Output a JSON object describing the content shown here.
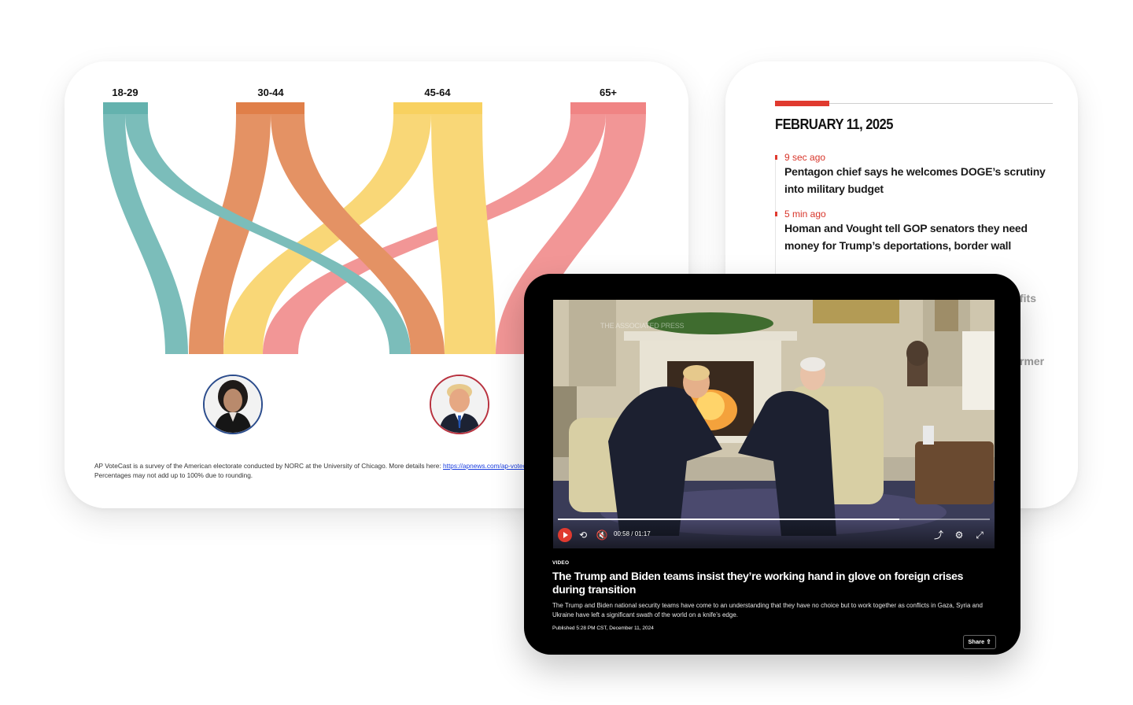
{
  "chart_card": {
    "age_groups": [
      "18-29",
      "30-44",
      "45-64",
      "65+"
    ],
    "footnote_line1": "AP VoteCast is a survey of the American electorate conducted by NORC at the University of Chicago. More details here: ",
    "footnote_link": "https://apnews.com/ap-votecast-fa",
    "footnote_line2": "Percentages may not add up to 100% due to rounding."
  },
  "colors": {
    "teal": "#64b2ae",
    "orange": "#e07f49",
    "yellow": "#f8d160",
    "pink": "#f08484",
    "harris_ring": "#2b4c8c",
    "trump_ring": "#b8323f",
    "accent_red": "#e03a2f"
  },
  "news_card": {
    "date": "FEBRUARY 11, 2025",
    "items": [
      {
        "time": "9 sec ago",
        "headline": "Pentagon chief says he welcomes DOGE’s scrutiny into military budget"
      },
      {
        "time": "5 min ago",
        "headline": "Homan and Vought tell GOP senators they need money for Trump’s deportations, border wall"
      }
    ],
    "ghost_text_1": "fits",
    "ghost_text_2": "rmer"
  },
  "video": {
    "watermark": "THE ASSOCIATED PRESS",
    "progress": 0.79,
    "time_current": "00:58",
    "time_separator": "/",
    "time_total": "01:17",
    "kicker": "VIDEO",
    "title": "The Trump and Biden teams insist they’re working hand in glove on foreign crises during transition",
    "description": "The Trump and Biden national security teams have come to an understanding that they have no choice but to work together as conflicts in Gaza, Syria and Ukraine have left a significant swath of the world on a knife’s edge.",
    "published": "Published 5:28 PM CST, December 11, 2024",
    "share_label": "Share",
    "icons": [
      "play-icon",
      "rewind-10-icon",
      "mute-icon",
      "share-icon",
      "settings-icon",
      "fullscreen-icon"
    ]
  }
}
